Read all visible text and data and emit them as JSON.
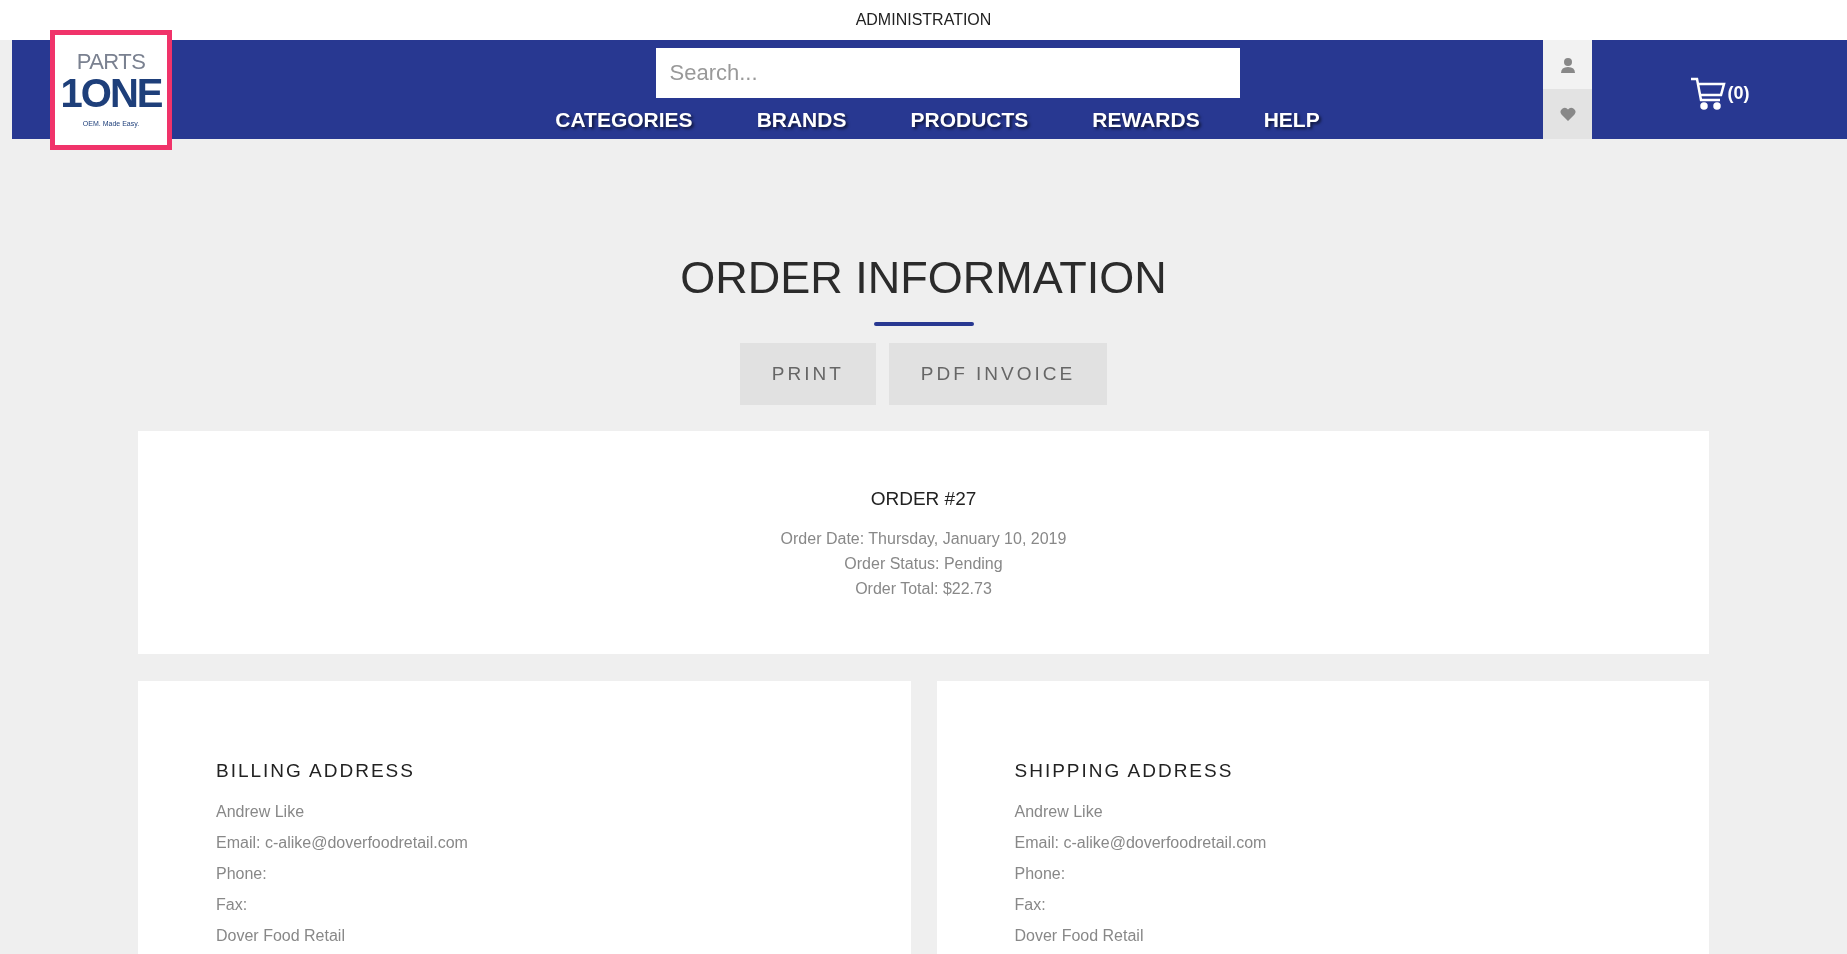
{
  "top_bar": {
    "title": "ADMINISTRATION"
  },
  "logo": {
    "word_top": "PARTS",
    "digit": "1",
    "word_main": "ONE",
    "tagline": "OEM. Made Easy.",
    "highlighted": true
  },
  "search": {
    "placeholder": "Search..."
  },
  "nav": [
    "CATEGORIES",
    "BRANDS",
    "PRODUCTS",
    "REWARDS",
    "HELP"
  ],
  "cart": {
    "count": "(0)"
  },
  "page_title": "ORDER INFORMATION",
  "buttons": [
    "PRINT",
    "PDF INVOICE"
  ],
  "order": {
    "title": "ORDER #27",
    "lines": [
      "Order Date: Thursday, January 10, 2019",
      "Order Status: Pending",
      "Order Total: $22.73"
    ]
  },
  "addresses": [
    {
      "title": "BILLING ADDRESS",
      "lines": [
        "Andrew Like",
        "Email: c-alike@doverfoodretail.com",
        "Phone:",
        "Fax:",
        "Dover Food Retail"
      ]
    },
    {
      "title": "SHIPPING ADDRESS",
      "lines": [
        "Andrew Like",
        "Email: c-alike@doverfoodretail.com",
        "Phone:",
        "Fax:",
        "Dover Food Retail"
      ]
    }
  ]
}
